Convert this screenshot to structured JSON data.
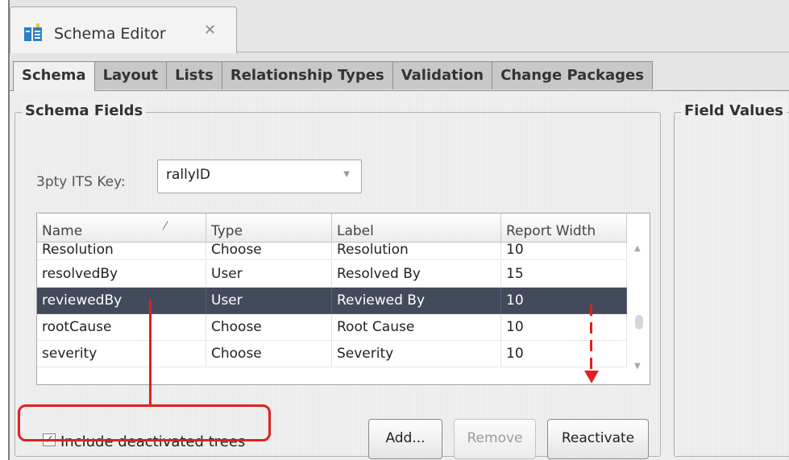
{
  "editor_tab": {
    "title": "Schema Editor",
    "close_glyph": "✕",
    "icon": "schema-editor-icon"
  },
  "subtabs": [
    {
      "label": "Schema",
      "active": true
    },
    {
      "label": "Layout",
      "active": false
    },
    {
      "label": "Lists",
      "active": false
    },
    {
      "label": "Relationship Types",
      "active": false
    },
    {
      "label": "Validation",
      "active": false
    },
    {
      "label": "Change Packages",
      "active": false
    }
  ],
  "schema_fields": {
    "title": "Schema Fields",
    "key_label": "3pty ITS Key:",
    "key_value": "rallyID",
    "table": {
      "columns": [
        "Name",
        "Type",
        "Label",
        "Report Width"
      ],
      "sort_indicator": "⁄",
      "rows": [
        {
          "name": "Resolution",
          "type": "Choose",
          "label": "Resolution",
          "width": "10",
          "selected": false
        },
        {
          "name": "resolvedBy",
          "type": "User",
          "label": "Resolved By",
          "width": "15",
          "selected": false
        },
        {
          "name": "reviewedBy",
          "type": "User",
          "label": "Reviewed By",
          "width": "10",
          "selected": true
        },
        {
          "name": "rootCause",
          "type": "Choose",
          "label": "Root Cause",
          "width": "10",
          "selected": false
        },
        {
          "name": "severity",
          "type": "Choose",
          "label": "Severity",
          "width": "10",
          "selected": false
        }
      ]
    },
    "include_deactivated": {
      "label": "Include deactivated trees",
      "checked": true,
      "check_glyph": "☑"
    },
    "buttons": {
      "add": "Add...",
      "remove": "Remove",
      "reactivate": "Reactivate"
    }
  },
  "field_values": {
    "title": "Field Values"
  },
  "colors": {
    "selection": "#424a5b",
    "annotation": "#e02020"
  }
}
